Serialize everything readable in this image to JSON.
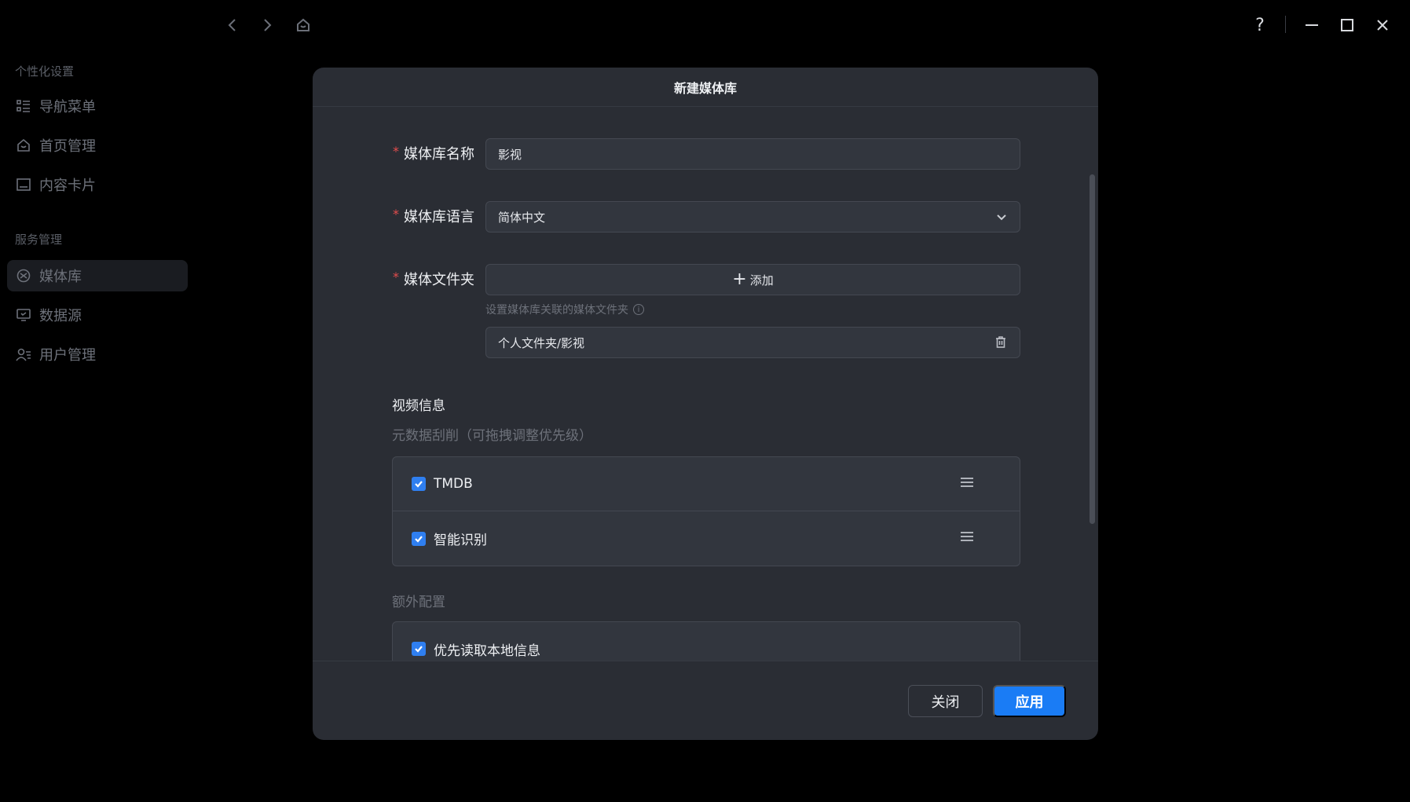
{
  "window": {
    "help_label": "?"
  },
  "sidebar": {
    "sections": [
      {
        "title": "个性化设置",
        "items": [
          {
            "label": "导航菜单",
            "icon": "list-icon"
          },
          {
            "label": "首页管理",
            "icon": "home-icon"
          },
          {
            "label": "内容卡片",
            "icon": "card-icon"
          }
        ]
      },
      {
        "title": "服务管理",
        "items": [
          {
            "label": "媒体库",
            "icon": "media-library-icon",
            "active": true
          },
          {
            "label": "数据源",
            "icon": "data-source-icon"
          },
          {
            "label": "用户管理",
            "icon": "users-icon"
          }
        ]
      }
    ]
  },
  "modal": {
    "title": "新建媒体库",
    "fields": {
      "name": {
        "label": "媒体库名称",
        "value": "影视"
      },
      "language": {
        "label": "媒体库语言",
        "value": "简体中文"
      },
      "folder": {
        "label": "媒体文件夹",
        "add_label": "添加",
        "hint": "设置媒体库关联的媒体文件夹",
        "folders": [
          "个人文件夹/影视"
        ]
      }
    },
    "video_info": {
      "title": "视频信息",
      "scrape_subtitle": "元数据刮削（可拖拽调整优先级）",
      "scrapers": [
        {
          "label": "TMDB",
          "checked": true
        },
        {
          "label": "智能识别",
          "checked": true
        }
      ],
      "extra_title": "额外配置",
      "extra_options": [
        {
          "label": "优先读取本地信息",
          "checked": true
        }
      ]
    },
    "buttons": {
      "close": "关闭",
      "apply": "应用"
    }
  },
  "colors": {
    "accent": "#1a7cf5",
    "required": "#e34d4d",
    "modal_bg": "#2a2d34"
  }
}
